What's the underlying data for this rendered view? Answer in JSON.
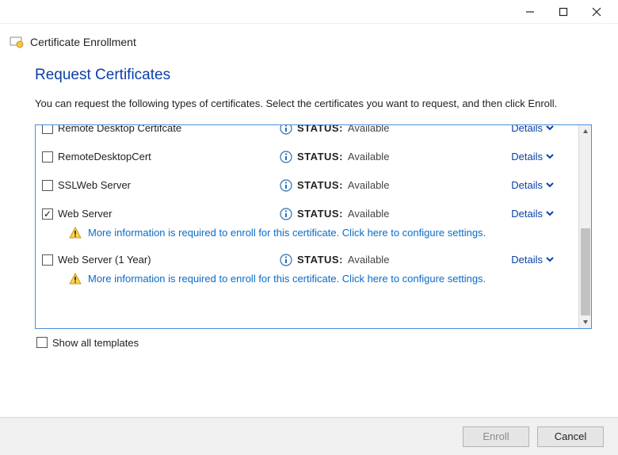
{
  "window": {
    "title": "Certificate Enrollment"
  },
  "page": {
    "heading": "Request Certificates",
    "intro": "You can request the following types of certificates. Select the certificates you want to request, and then click Enroll."
  },
  "status_label": "STATUS:",
  "details_label": "Details",
  "warning_text": "More information is required to enroll for this certificate. Click here to configure settings.",
  "rows": [
    {
      "name": "Remote Desktop Certifcate",
      "checked": false,
      "status": "Available",
      "warn": false
    },
    {
      "name": "RemoteDesktopCert",
      "checked": false,
      "status": "Available",
      "warn": false
    },
    {
      "name": "SSLWeb Server",
      "checked": false,
      "status": "Available",
      "warn": false
    },
    {
      "name": "Web Server",
      "checked": true,
      "status": "Available",
      "warn": true
    },
    {
      "name": "Web Server (1 Year)",
      "checked": false,
      "status": "Available",
      "warn": true
    }
  ],
  "show_all": {
    "label": "Show all templates",
    "checked": false
  },
  "buttons": {
    "enroll": "Enroll",
    "cancel": "Cancel"
  }
}
